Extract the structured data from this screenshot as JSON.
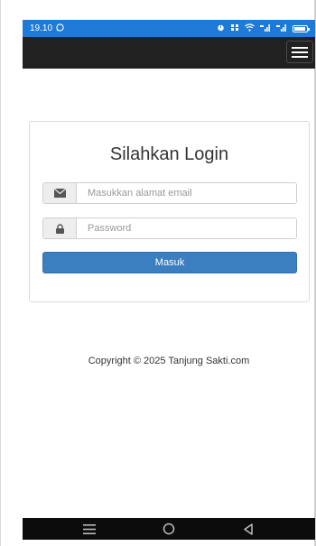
{
  "status_bar": {
    "time": "19.10",
    "colors": {
      "background": "#1e7ad6"
    }
  },
  "navbar": {
    "background": "#212121"
  },
  "login": {
    "title": "Silahkan Login",
    "email": {
      "placeholder": "Masukkan alamat email",
      "value": "",
      "icon": "envelope-icon"
    },
    "password": {
      "placeholder": "Password",
      "value": "",
      "icon": "lock-icon"
    },
    "submit_label": "Masuk",
    "colors": {
      "button": "#3c7fc1"
    }
  },
  "footer": {
    "copyright": "Copyright © 2025 Tanjung Sakti.com"
  },
  "nav_bar": {
    "buttons": [
      "recent-apps-icon",
      "home-icon",
      "back-icon"
    ]
  }
}
